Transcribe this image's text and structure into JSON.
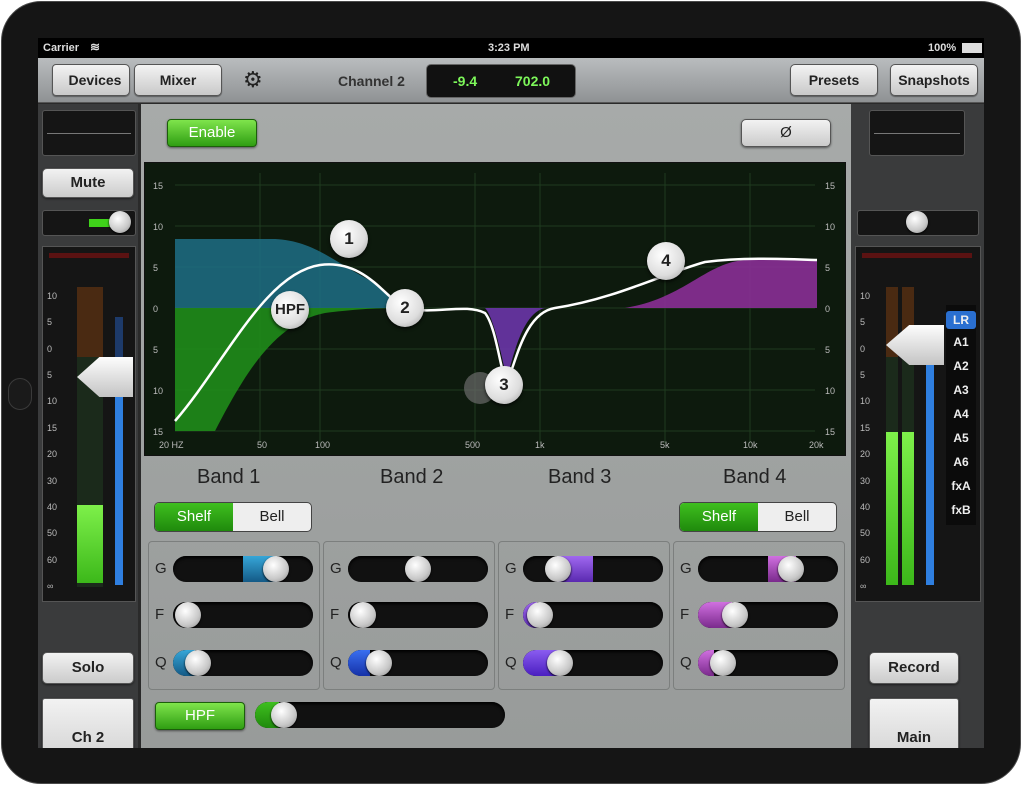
{
  "status": {
    "carrier": "Carrier",
    "time": "3:23 PM",
    "battery": "100%"
  },
  "toolbar": {
    "devices": "Devices",
    "mixer": "Mixer",
    "channel_label": "Channel 2",
    "readout_db": "-9.4",
    "readout_hz": "702.0",
    "presets": "Presets",
    "snapshots": "Snapshots"
  },
  "left_strip": {
    "mute": "Mute",
    "solo": "Solo",
    "channel": "Ch 2",
    "scale": [
      "10",
      "5",
      "0",
      "5",
      "10",
      "15",
      "20",
      "30",
      "40",
      "50",
      "60",
      "∞"
    ]
  },
  "right_strip": {
    "record": "Record",
    "main": "Main",
    "buses": [
      "LR",
      "A1",
      "A2",
      "A3",
      "A4",
      "A5",
      "A6",
      "fxA",
      "fxB"
    ],
    "scale": [
      "10",
      "5",
      "0",
      "5",
      "10",
      "15",
      "20",
      "30",
      "40",
      "50",
      "60",
      "∞"
    ]
  },
  "eq": {
    "enable": "Enable",
    "phase": "Ø",
    "db_ticks": [
      "15",
      "10",
      "5",
      "0",
      "5",
      "10",
      "15"
    ],
    "freq_ticks": [
      "20 HZ",
      "50",
      "100",
      "500",
      "1k",
      "5k",
      "10k",
      "20k"
    ],
    "nodes": [
      "1",
      "HPF",
      "2",
      "3",
      "4"
    ],
    "bands": [
      "Band 1",
      "Band 2",
      "Band 3",
      "Band 4"
    ],
    "shelf": "Shelf",
    "bell": "Bell",
    "param_labels": {
      "gain": "G",
      "freq": "F",
      "q": "Q"
    },
    "hpf": "HPF"
  },
  "colors": {
    "band1": "#1f8fb8",
    "band2": "#1f8fb8",
    "band3": "#7a3fc4",
    "band4": "#a93fb8",
    "enable_green": "#3fb11d"
  }
}
